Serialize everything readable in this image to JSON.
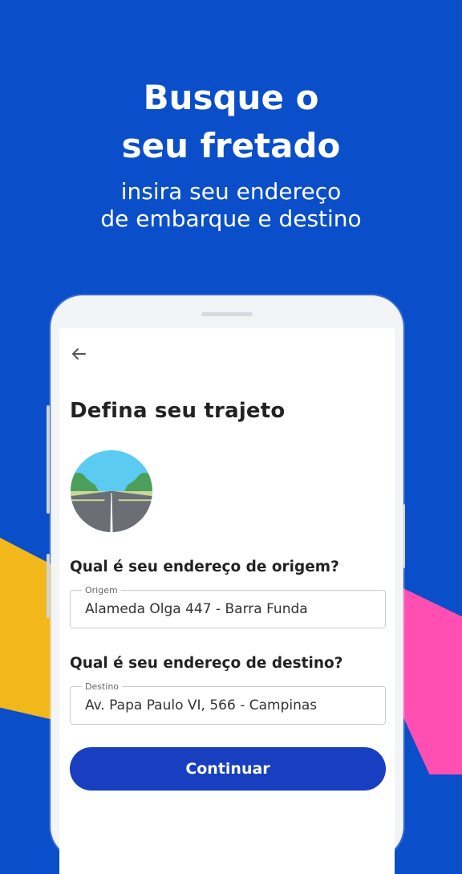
{
  "promo": {
    "title_line1": "Busque o",
    "title_line2": "seu fretado",
    "subtitle_line1": "insira seu endereço",
    "subtitle_line2": "de embarque e destino"
  },
  "screen": {
    "title": "Defina seu trajeto",
    "origin": {
      "question": "Qual é seu endereço de origem?",
      "caption": "Origem",
      "value": "Alameda Olga 447 - Barra Funda"
    },
    "destination": {
      "question": "Qual é seu endereço de destino?",
      "caption": "Destino",
      "value": "Av. Papa Paulo VI, 566 - Campinas"
    },
    "continue_label": "Continuar"
  },
  "colors": {
    "background": "#0a4ec9",
    "button": "#173fbf",
    "accent_yellow": "#f2b81b",
    "accent_pink": "#ff4fb2"
  },
  "icons": [
    "arrow-left-icon",
    "road-illustration"
  ]
}
